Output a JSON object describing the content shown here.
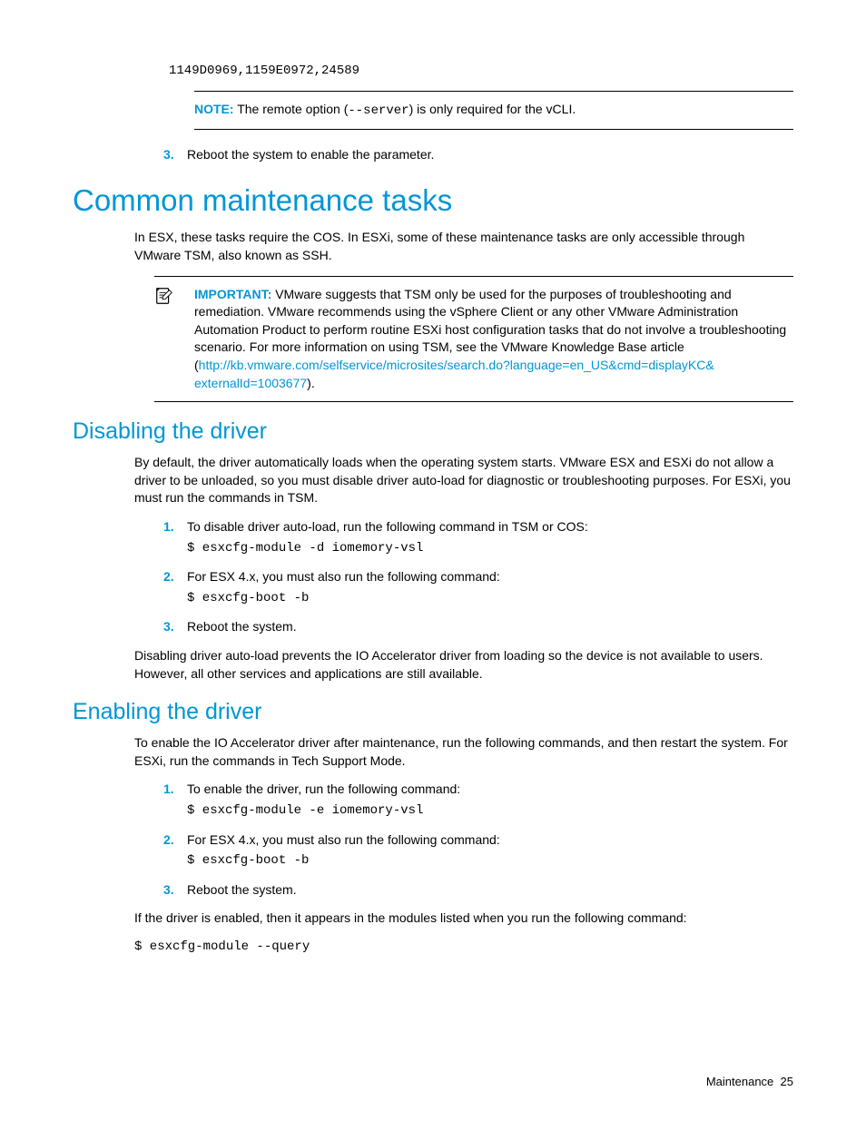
{
  "top_code": "1149D0969,1159E0972,24589",
  "note": {
    "label": "NOTE:",
    "before": "The remote option (",
    "code": "--server",
    "after": ") is only required for the vCLI."
  },
  "step3_top": "Reboot the system to enable the parameter.",
  "h1": "Common maintenance tasks",
  "intro": "In ESX, these tasks require the COS. In ESXi, some of these maintenance tasks are only accessible through VMware TSM, also known as SSH.",
  "important": {
    "label": "IMPORTANT:",
    "body": "VMware suggests that TSM only be used for the purposes of troubleshooting and remediation. VMware recommends using the vSphere Client or any other VMware Administration Automation Product to perform routine ESXi host configuration tasks that do not involve a troubleshooting scenario. For more information on using TSM, see the VMware Knowledge Base article",
    "link_open": "(",
    "link_line1": "http://kb.vmware.com/selfservice/microsites/search.do?language=en_US&cmd=displayKC&",
    "link_line2": "externalId=1003677",
    "link_close": ")."
  },
  "disable": {
    "heading": "Disabling the driver",
    "intro": "By default, the driver automatically loads when the operating system starts. VMware ESX and ESXi do not allow a driver to be unloaded, so you must disable driver auto-load for diagnostic or troubleshooting purposes. For ESXi, you must run the commands in TSM.",
    "steps": {
      "s1_text": "To disable driver auto-load, run the following command in TSM or COS:",
      "s1_cmd": "$ esxcfg-module -d iomemory-vsl",
      "s2_text": "For ESX 4.x, you must also run the following command:",
      "s2_cmd": "$ esxcfg-boot -b",
      "s3_text": "Reboot the system."
    },
    "outro": "Disabling driver auto-load prevents the IO Accelerator driver from loading so the device is not available to users. However, all other services and applications are still available."
  },
  "enable": {
    "heading": "Enabling the driver",
    "intro": "To enable the IO Accelerator driver after maintenance, run the following commands, and then restart the system. For ESXi, run the commands in Tech Support Mode.",
    "steps": {
      "s1_text": "To enable the driver, run the following command:",
      "s1_cmd": "$ esxcfg-module -e iomemory-vsl",
      "s2_text": "For ESX 4.x, you must also run the following command:",
      "s2_cmd": "$ esxcfg-boot -b",
      "s3_text": "Reboot the system."
    },
    "outro": "If the driver is enabled, then it appears in the modules listed when you run the following command:",
    "cmd": "$ esxcfg-module --query"
  },
  "footer": {
    "section": "Maintenance",
    "page": "25"
  }
}
